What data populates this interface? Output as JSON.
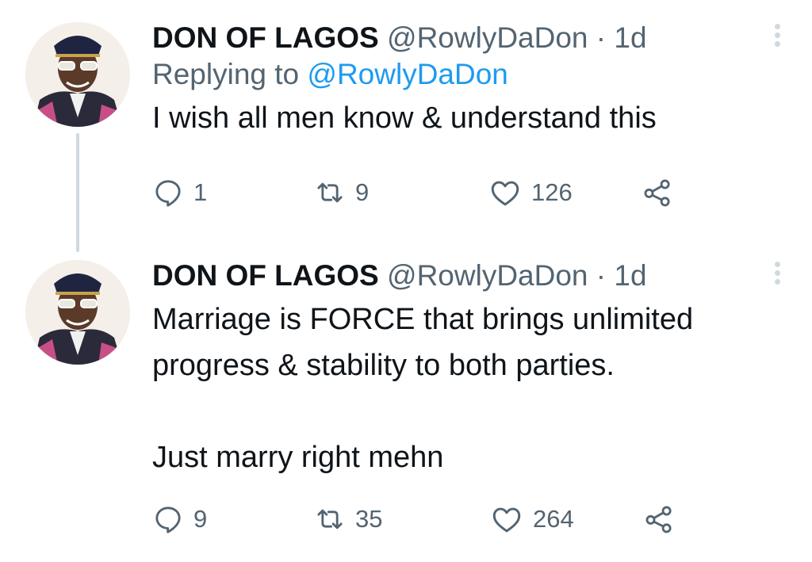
{
  "tweets": [
    {
      "display_name": "DON OF LAGOS",
      "handle": "@RowlyDaDon",
      "separator": " · ",
      "time": "1d",
      "replying_prefix": "Replying to ",
      "replying_to": "@RowlyDaDon",
      "text": "I wish all men know & understand this",
      "replies": "1",
      "retweets": "9",
      "likes": "126"
    },
    {
      "display_name": "DON OF LAGOS",
      "handle": "@RowlyDaDon",
      "separator": " · ",
      "time": "1d",
      "text": "Marriage is FORCE that brings unlimited\nprogress & stability to both parties.\n\nJust marry right mehn",
      "replies": "9",
      "retweets": "35",
      "likes": "264"
    }
  ],
  "icons": {
    "reply": "reply-icon",
    "retweet": "retweet-icon",
    "like": "heart-icon",
    "share": "share-icon",
    "more": "more-vertical-icon"
  },
  "colors": {
    "text": "#0f1419",
    "muted": "#536471",
    "link": "#1d9bf0",
    "thread_line": "#cfd9de"
  }
}
